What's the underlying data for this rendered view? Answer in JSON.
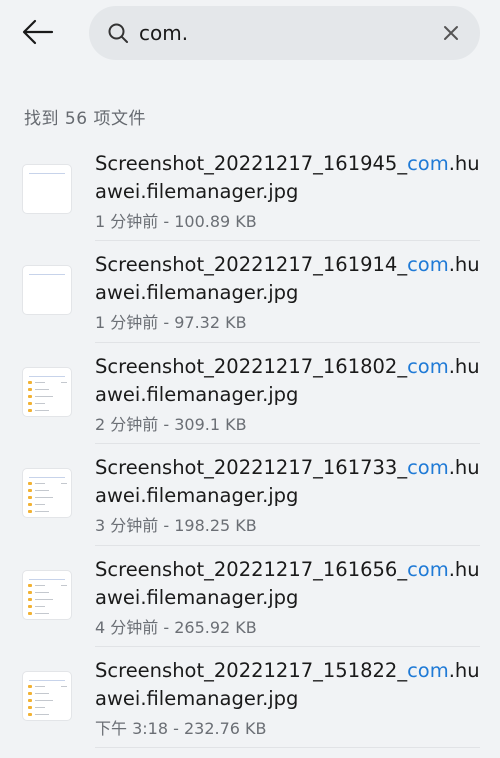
{
  "search": {
    "query": "com.",
    "placeholder": ""
  },
  "results": {
    "summary": "找到 56 项文件",
    "items": [
      {
        "prefix": "Screenshot_20221217_161945_",
        "match": "com",
        "suffix": ".huawei.filemanager.jpg",
        "time": "1 分钟前",
        "size": "100.89 KB",
        "thumb": "blank"
      },
      {
        "prefix": "Screenshot_20221217_161914_",
        "match": "com",
        "suffix": ".huawei.filemanager.jpg",
        "time": "1 分钟前",
        "size": "97.32 KB",
        "thumb": "blank"
      },
      {
        "prefix": "Screenshot_20221217_161802_",
        "match": "com",
        "suffix": ".huawei.filemanager.jpg",
        "time": "2 分钟前",
        "size": "309.1 KB",
        "thumb": "list"
      },
      {
        "prefix": "Screenshot_20221217_161733_",
        "match": "com",
        "suffix": ".huawei.filemanager.jpg",
        "time": "3 分钟前",
        "size": "198.25 KB",
        "thumb": "list"
      },
      {
        "prefix": "Screenshot_20221217_161656_",
        "match": "com",
        "suffix": ".huawei.filemanager.jpg",
        "time": "4 分钟前",
        "size": "265.92 KB",
        "thumb": "list"
      },
      {
        "prefix": "Screenshot_20221217_151822_",
        "match": "com",
        "suffix": ".huawei.filemanager.jpg",
        "time": "下午 3:18 ",
        "size": "232.76 KB",
        "thumb": "list"
      }
    ]
  },
  "icons": {
    "back": "back-arrow-icon",
    "search": "search-icon",
    "clear": "close-icon"
  },
  "colors": {
    "highlight": "#1f7ad6",
    "background": "#f1f3f5",
    "search_bg": "#e4e7ea"
  }
}
